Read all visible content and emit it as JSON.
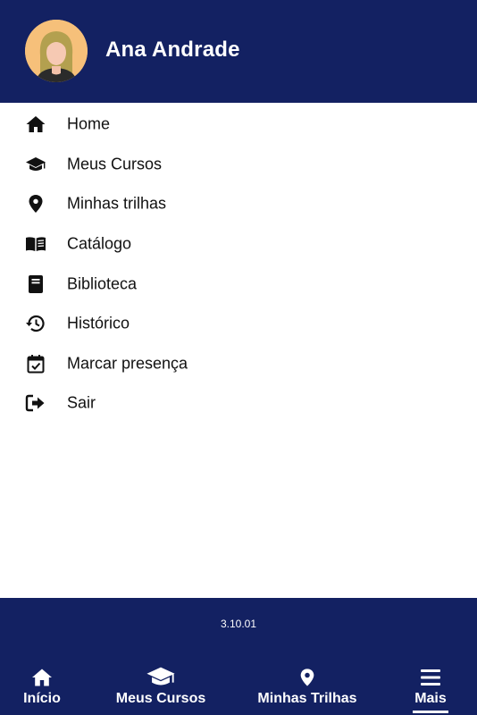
{
  "header": {
    "user_name": "Ana Andrade",
    "background_color": "#132162"
  },
  "menu": {
    "items": [
      {
        "label": "Home",
        "icon": "home-icon"
      },
      {
        "label": "Meus Cursos",
        "icon": "graduation-cap-icon"
      },
      {
        "label": "Minhas trilhas",
        "icon": "map-pin-icon"
      },
      {
        "label": "Catálogo",
        "icon": "open-book-icon"
      },
      {
        "label": "Biblioteca",
        "icon": "book-icon"
      },
      {
        "label": "Histórico",
        "icon": "history-icon"
      },
      {
        "label": "Marcar presença",
        "icon": "calendar-check-icon"
      },
      {
        "label": "Sair",
        "icon": "sign-out-icon"
      }
    ]
  },
  "footer": {
    "version": "3.10.01",
    "tabs": [
      {
        "label": "Início",
        "icon": "home-icon"
      },
      {
        "label": "Meus Cursos",
        "icon": "graduation-cap-icon"
      },
      {
        "label": "Minhas Trilhas",
        "icon": "map-pin-icon"
      },
      {
        "label": "Mais",
        "icon": "hamburger-menu-icon",
        "active": true
      }
    ]
  }
}
